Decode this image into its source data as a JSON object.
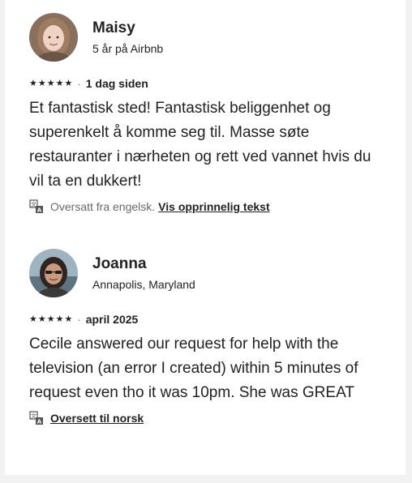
{
  "reviews": [
    {
      "name": "Maisy",
      "subtitle": "5 år på Airbnb",
      "rating": 5,
      "stars": [
        "★",
        "★",
        "★",
        "★",
        "★"
      ],
      "separator": "·",
      "date": "1 dag siden",
      "text": "Et fantastisk sted! Fantastisk beliggenhet og superenkelt å komme seg til. Masse søte restauranter i nærheten og rett ved vannet hvis du vil ta en dukkert!",
      "translation_note": "Oversatt fra engelsk.",
      "translation_link": "Vis opprinnelig tekst",
      "avatar_icon": "profile-photo"
    },
    {
      "name": "Joanna",
      "subtitle": "Annapolis, Maryland",
      "rating": 5,
      "stars": [
        "★",
        "★",
        "★",
        "★",
        "★"
      ],
      "separator": "·",
      "date": "april 2025",
      "text": "Cecile answered our request for help with the television (an error I created) within 5 minutes of request even tho it was 10pm.  She was GREAT",
      "translation_note": "",
      "translation_link": "Oversett til norsk",
      "avatar_icon": "profile-photo"
    }
  ],
  "colors": {
    "text": "#222222",
    "muted": "#6a6a6a",
    "background": "#f2f2f2",
    "card": "#ffffff"
  }
}
